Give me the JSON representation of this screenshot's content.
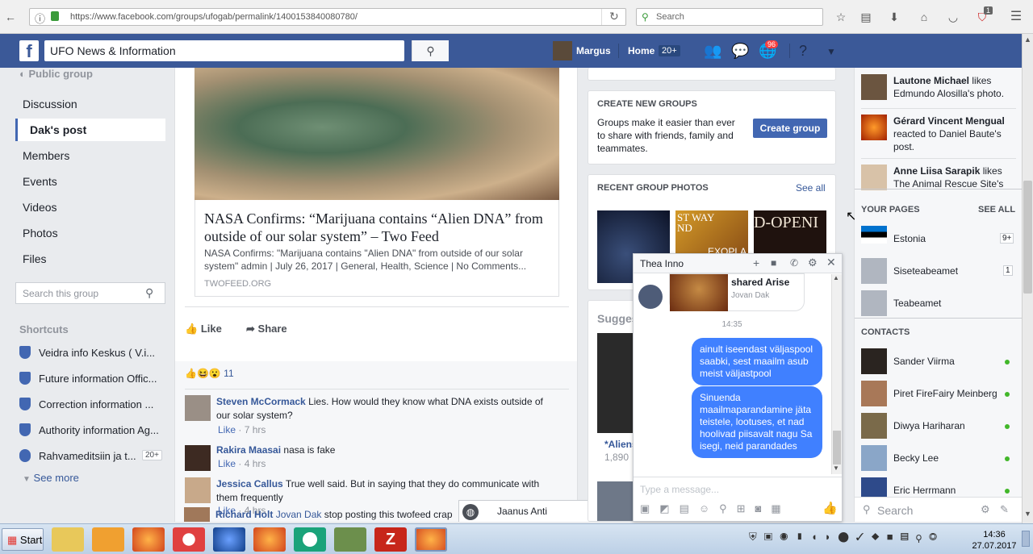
{
  "browser": {
    "url": "https://www.facebook.com/groups/ufogab/permalink/1400153840080780/",
    "search_placeholder": "Search",
    "notification_badge": "1"
  },
  "fbheader": {
    "search_value": "UFO News & Information",
    "user_name": "Margus",
    "home_label": "Home",
    "home_count": "20+",
    "notif_count": "96"
  },
  "leftnav": {
    "group_type": "Public group",
    "items": [
      "Discussion",
      "Dak's post",
      "Members",
      "Events",
      "Videos",
      "Photos",
      "Files"
    ],
    "search_placeholder": "Search this group",
    "shortcuts_title": "Shortcuts",
    "shortcuts": [
      {
        "label": "Veidra info Keskus ( V.i..."
      },
      {
        "label": "Future information Offic..."
      },
      {
        "label": "Correction information ..."
      },
      {
        "label": "Authority information Ag..."
      },
      {
        "label": "Rahvameditsiin ja t...",
        "badge": "20+"
      }
    ],
    "see_more": "See more"
  },
  "post": {
    "link_title": "NASA Confirms: “Marijuana contains “Alien DNA” from outside of our solar system” – Two Feed",
    "link_desc": "NASA Confirms: \"Marijuana contains \"Alien DNA\" from outside of our solar system\" admin | July 26, 2017 | General, Health, Science | No Comments...",
    "link_domain": "TWOFEED.ORG",
    "like_label": "Like",
    "share_label": "Share",
    "reaction_count": "11",
    "comments": [
      {
        "name": "Steven McCormack",
        "text": "Lies. How would they know what DNA exists outside of our solar system?",
        "like": "Like",
        "time": "7 hrs"
      },
      {
        "name": "Rakira Maasai",
        "text": "nasa is fake",
        "like": "Like",
        "time": "4 hrs"
      },
      {
        "name": "Jessica Callus",
        "text": "True well said. But in saying that they do communicate with them frequently",
        "like": "Like",
        "time": "4 hrs"
      },
      {
        "name": "Richard Holt",
        "mention": "Jovan Dak",
        "text": "stop posting this twofeed crap"
      }
    ],
    "mini_chat_name": "Jaanus Anti"
  },
  "rightcol": {
    "create_title": "CREATE NEW GROUPS",
    "create_text": "Groups make it easier than ever to share with friends, family and teammates.",
    "create_button": "Create group",
    "photos_title": "RECENT GROUP PHOTOS",
    "photos_see_all": "See all",
    "photo1_text": "ST WAY\nND",
    "photo1_sub": "EXOPLA",
    "photo2_text": "D-OPENI",
    "suggested_title": "Sugges",
    "suggested_item": "*Aliens",
    "suggested_count": "1,890"
  },
  "chat": {
    "name": "Thea Inno",
    "shared_text": "shared Arise",
    "shared_by": "Jovan Dak",
    "time": "14:35",
    "msg1": "ainult iseendast väljaspool saabki, sest maailm asub meist väljastpool",
    "msg2": "Sinuenda maailmaparandamine jäta teistele, lootuses, et nad hoolivad piisavalt nagu Sa isegi, neid parandades",
    "input_placeholder": "Type a message..."
  },
  "sidebar": {
    "ticker": [
      {
        "name": "Lautone Michael",
        "rest": "likes Edmundo Alosilla's photo."
      },
      {
        "name": "Gérard Vincent Mengual",
        "rest": "reacted to Daniel Baute's post."
      },
      {
        "name": "Anne Liisa Sarapik",
        "rest": "likes The Animal Rescue Site's"
      }
    ],
    "pages_title": "YOUR PAGES",
    "pages_see_all": "SEE ALL",
    "pages": [
      {
        "name": "Estonia",
        "badge": "9+"
      },
      {
        "name": "Siseteabeamet",
        "badge": "1"
      },
      {
        "name": "Teabeamet",
        "badge": ""
      }
    ],
    "contacts_title": "CONTACTS",
    "contacts": [
      "Sander Viirma",
      "Piret FireFairy Meinberg",
      "Diwya Hariharan",
      "Becky Lee",
      "Eric Herrmann"
    ],
    "search_placeholder": "Search"
  },
  "taskbar": {
    "start": "Start",
    "time": "14:36",
    "date": "27.07.2017"
  }
}
